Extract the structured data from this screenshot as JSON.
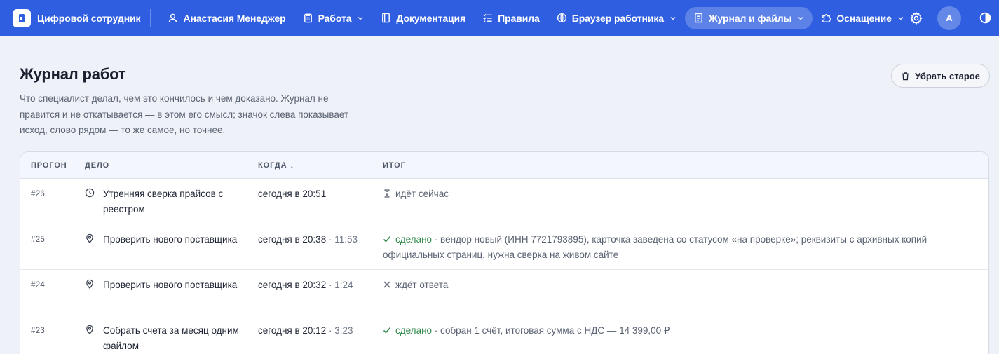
{
  "brand": {
    "name": "Цифровой сотрудник"
  },
  "nav": {
    "items": [
      {
        "label": "Анастасия Менеджер",
        "icon": "user-icon",
        "dropdown": false,
        "active": false
      },
      {
        "label": "Работа",
        "icon": "clipboard-icon",
        "dropdown": true,
        "active": false
      },
      {
        "label": "Документация",
        "icon": "book-icon",
        "dropdown": false,
        "active": false
      },
      {
        "label": "Правила",
        "icon": "checklist-icon",
        "dropdown": false,
        "active": false
      },
      {
        "label": "Браузер работника",
        "icon": "globe-icon",
        "dropdown": true,
        "active": false
      },
      {
        "label": "Журнал и файлы",
        "icon": "document-icon",
        "dropdown": true,
        "active": true
      },
      {
        "label": "Оснащение",
        "icon": "puzzle-icon",
        "dropdown": true,
        "active": false
      }
    ],
    "avatar_letter": "A"
  },
  "page": {
    "title": "Журнал работ",
    "description": "Что специалист делал, чем это кончилось и чем доказано. Журнал не правится и не откатывается — в этом его смысл; значок слева показывает исход, слово рядом — то же самое, но точнее.",
    "clean_button": "Убрать старое"
  },
  "table": {
    "columns": {
      "run": "ПРОГОН",
      "task": "ДЕЛО",
      "when": "КОГДА ↓",
      "result": "ИТОГ"
    },
    "rows": [
      {
        "id": "#26",
        "task_icon": "clock-icon",
        "task": "Утренняя сверка прайсов с реестром",
        "when": "сегодня в 20:51",
        "duration": "",
        "status_icon": "hourglass-icon",
        "status": "идёт сейчас",
        "status_kind": "grey",
        "detail": ""
      },
      {
        "id": "#25",
        "task_icon": "pin-icon",
        "task": "Проверить нового поставщика",
        "when": "сегодня в 20:38",
        "duration": " · 11:53",
        "status_icon": "check-icon",
        "status": "сделано",
        "status_kind": "done",
        "detail": " · вендор новый (ИНН 7721793895), карточка заведена со статусом «на проверке»; реквизиты с архивных копий официальных страниц, нужна сверка на живом сайте"
      },
      {
        "id": "#24",
        "task_icon": "pin-icon",
        "task": "Проверить нового поставщика",
        "when": "сегодня в 20:32",
        "duration": " · 1:24",
        "status_icon": "cross-icon",
        "status": "ждёт ответа",
        "status_kind": "grey",
        "detail": ""
      },
      {
        "id": "#23",
        "task_icon": "pin-icon",
        "task": "Собрать счета за месяц одним файлом",
        "when": "сегодня в 20:12",
        "duration": " · 3:23",
        "status_icon": "check-icon",
        "status": "сделано",
        "status_kind": "done",
        "detail": " · собран 1 счёт, итоговая сумма с НДС — 14 399,00 ₽"
      }
    ]
  },
  "colors": {
    "topbar": "#2f5fe0",
    "background": "#eef1f7",
    "done": "#2f8a4a",
    "muted": "#5a6272"
  }
}
